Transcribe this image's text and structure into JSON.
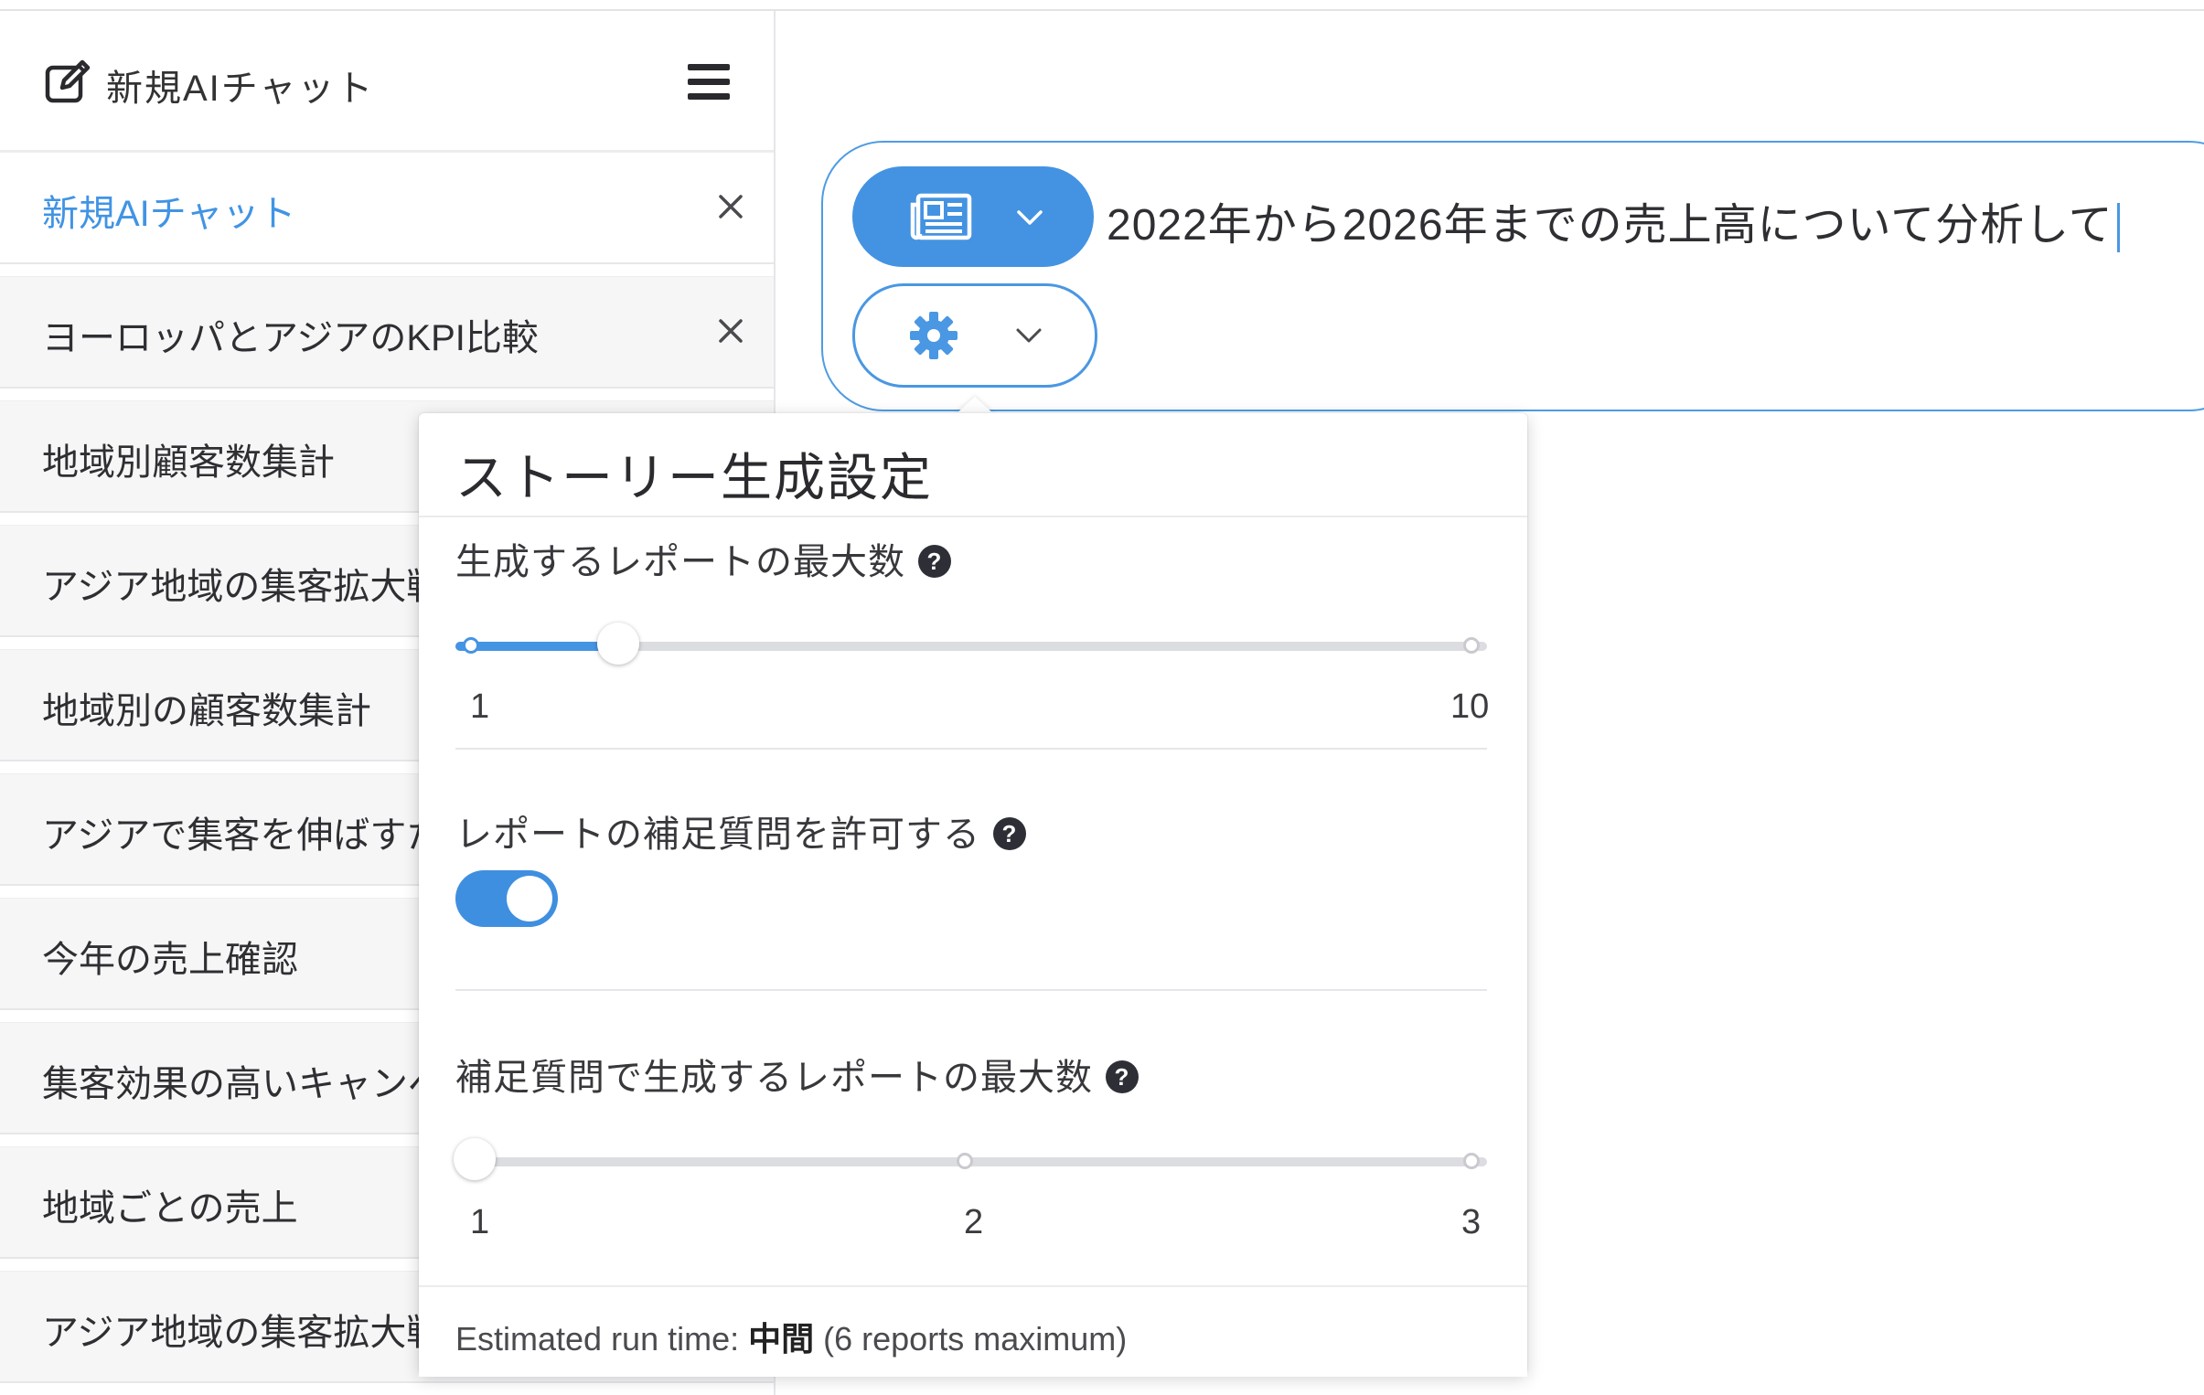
{
  "sidebar": {
    "new_chat_label": "新規AIチャット",
    "items": [
      {
        "label": "新規AIチャット",
        "active": true,
        "closable": true
      },
      {
        "label": "ヨーロッパとアジアのKPI比較",
        "active": false,
        "closable": true
      },
      {
        "label": "地域別顧客数集計",
        "active": false,
        "closable": false
      },
      {
        "label": "アジア地域の集客拡大戦",
        "active": false,
        "closable": false
      },
      {
        "label": "地域別の顧客数集計",
        "active": false,
        "closable": false
      },
      {
        "label": "アジアで集客を伸ばすた",
        "active": false,
        "closable": false
      },
      {
        "label": "今年の売上確認",
        "active": false,
        "closable": false
      },
      {
        "label": "集客効果の高いキャンペ",
        "active": false,
        "closable": false
      },
      {
        "label": "地域ごとの売上",
        "active": false,
        "closable": false
      },
      {
        "label": "アジア地域の集客拡大戦",
        "active": false,
        "closable": false
      }
    ]
  },
  "composer": {
    "query": "2022年から2026年までの売上高について分析して",
    "source_icon": "newspaper-icon",
    "settings_icon": "gear-icon"
  },
  "settings_popover": {
    "title": "ストーリー生成設定",
    "max_reports": {
      "label": "生成するレポートの最大数",
      "min_label": "1",
      "max_label": "10",
      "value": 2,
      "min": 1,
      "max": 10
    },
    "allow_followup": {
      "label": "レポートの補足質問を許可する",
      "enabled": true
    },
    "followup_max_reports": {
      "label": "補足質問で生成するレポートの最大数",
      "ticks": [
        "1",
        "2",
        "3"
      ],
      "value": 1
    },
    "footer": {
      "prefix": "Estimated run time: ",
      "level": "中間",
      "suffix": " (6 reports maximum)"
    }
  },
  "colors": {
    "accent": "#4594e3",
    "help_icon_bg": "#2e2f36",
    "track": "#dcdde1"
  }
}
